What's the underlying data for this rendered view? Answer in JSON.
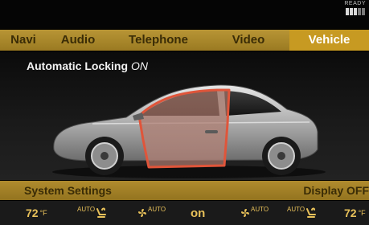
{
  "status": {
    "ready_label": "READY"
  },
  "nav": {
    "items": [
      "Navi",
      "Audio",
      "Telephone",
      "Video",
      "Vehicle"
    ],
    "active": "Vehicle"
  },
  "main": {
    "setting_label": "Automatic Locking",
    "setting_state": "ON"
  },
  "settings_bar": {
    "left_label": "System Settings",
    "right_label": "Display OFF"
  },
  "climate": {
    "left_temp": "72",
    "right_temp": "72",
    "unit": "°F",
    "auto_label": "AUTO",
    "center_label": "on"
  },
  "colors": {
    "accent_gold": "#b89535",
    "active_tab": "#c79a22",
    "door_highlight": "#e0553a"
  }
}
